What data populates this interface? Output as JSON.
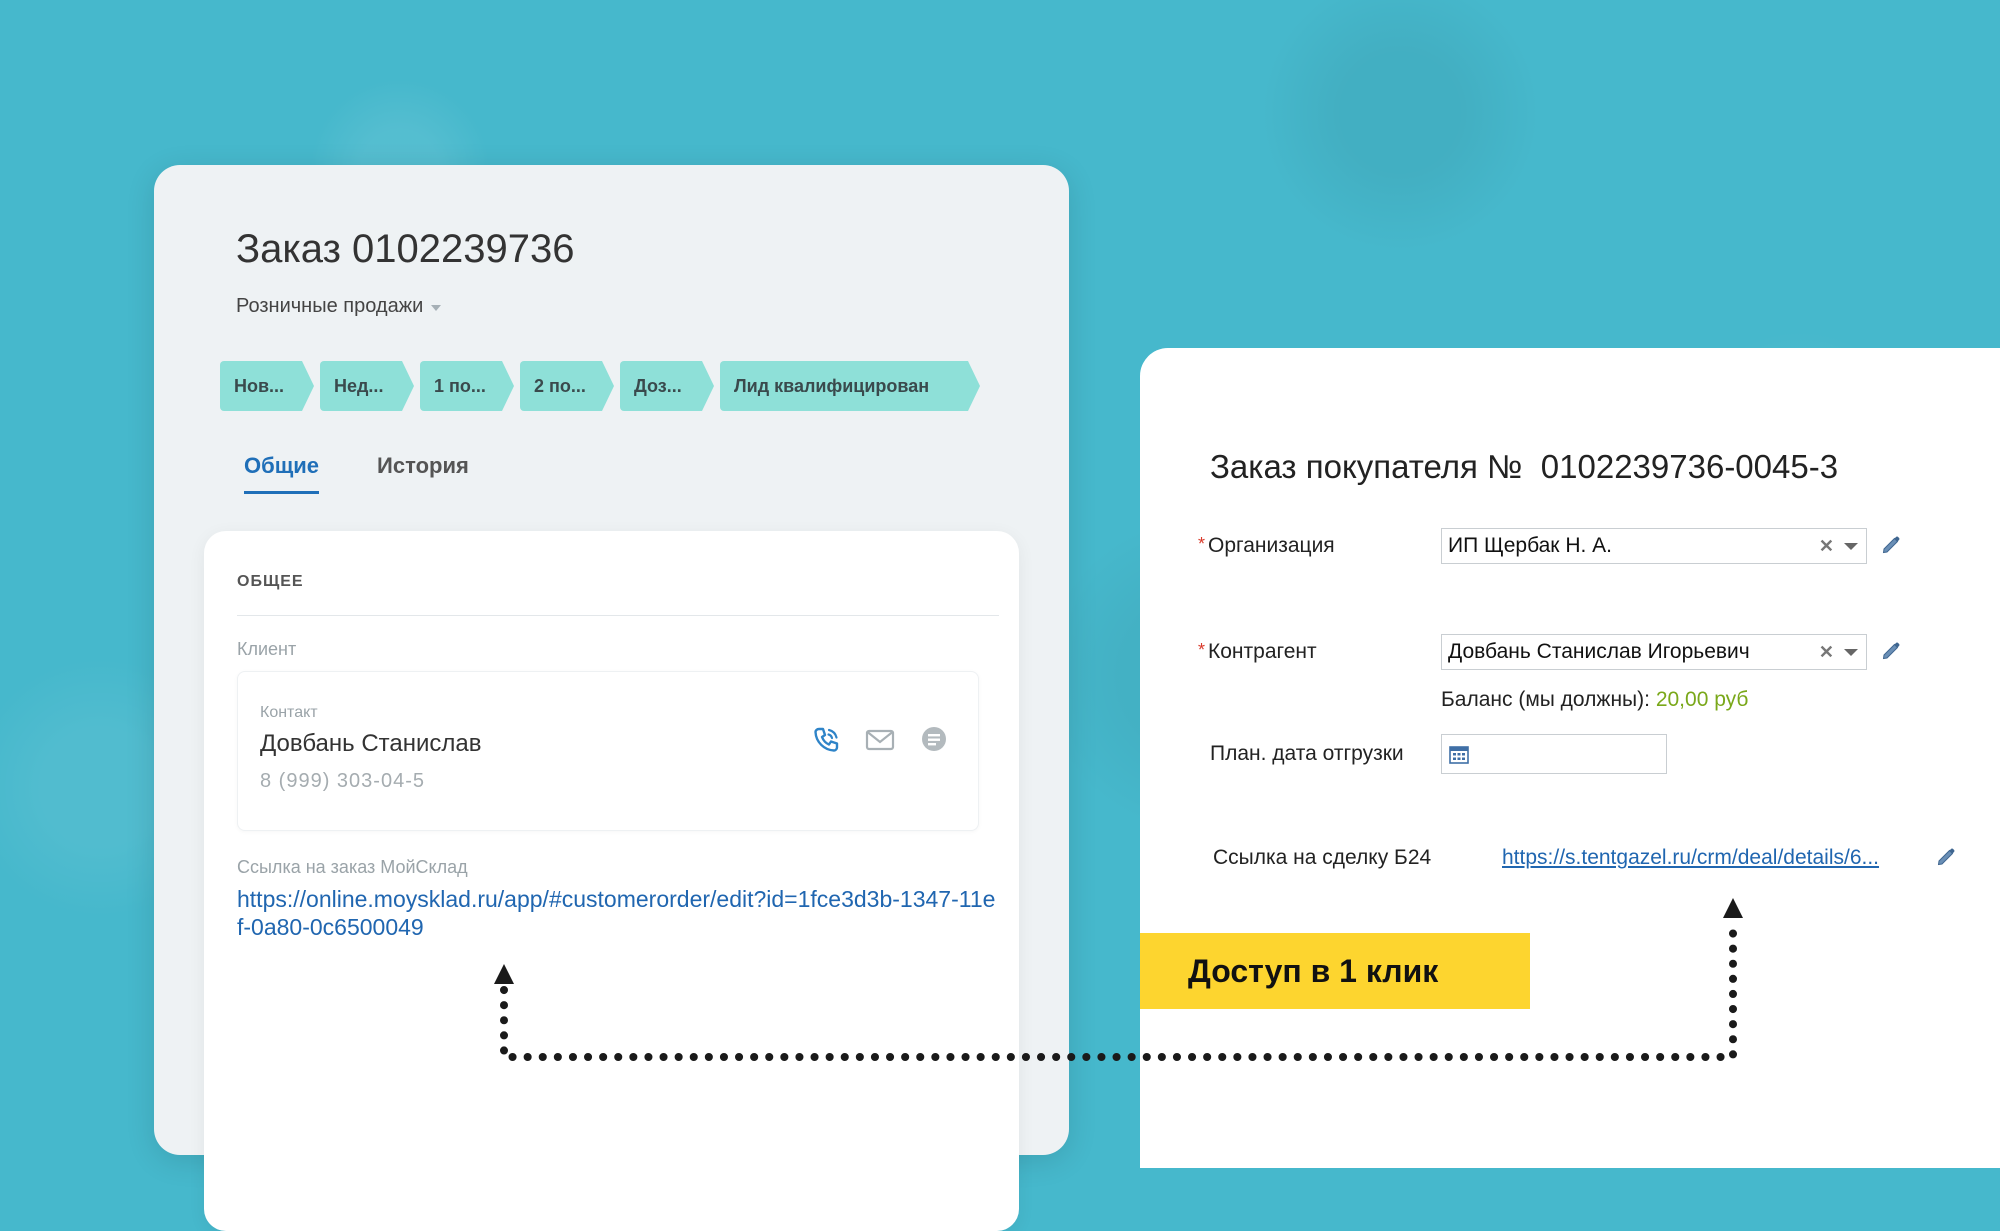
{
  "left": {
    "title": "Заказ 0102239736",
    "category": "Розничные продажи",
    "stages": [
      "Нов...",
      "Нед...",
      "1 по...",
      "2 по...",
      "Доз...",
      "Лид квалифицирован"
    ],
    "tabs": [
      "Общие",
      "История"
    ],
    "active_tab": "Общие",
    "section_title": "ОБЩЕЕ",
    "client_label": "Клиент",
    "contact": {
      "type": "Контакт",
      "name": "Довбань Станислав",
      "phone": "8 (999) 303-04-5"
    },
    "link_label": "Ссылка на заказ МойСклад",
    "link_value": "https://online.moysklad.ru/app/#customerorder/edit?id=1fce3d3b-1347-11ef-0a80-0c6500049"
  },
  "right": {
    "title": "Заказ покупателя №  0102239736-0045-3",
    "org_label": "Организация",
    "org_value": "ИП Щербак Н. А.",
    "counterparty_label": "Контрагент",
    "counterparty_value": "Довбань Станислав Игорьевич",
    "balance_label": "Баланс (мы должны):",
    "balance_amount": "20,00 руб",
    "ship_date_label": "План. дата отгрузки",
    "deal_link_label": "Ссылка на сделку Б24",
    "deal_link_value": "https://s.tentgazel.ru/crm/deal/details/6..."
  },
  "badge": "Доступ в 1 клик",
  "colors": {
    "background": "#46b8cc",
    "stage": "#8ee0d8",
    "link": "#2066b0",
    "active_tab": "#1f6fb8",
    "badge": "#fdd52f",
    "balance_amount": "#7aa81a"
  },
  "icons": [
    "phone-icon",
    "mail-icon",
    "chat-icon",
    "clear-icon",
    "dropdown-icon",
    "pencil-icon",
    "calendar-icon"
  ]
}
